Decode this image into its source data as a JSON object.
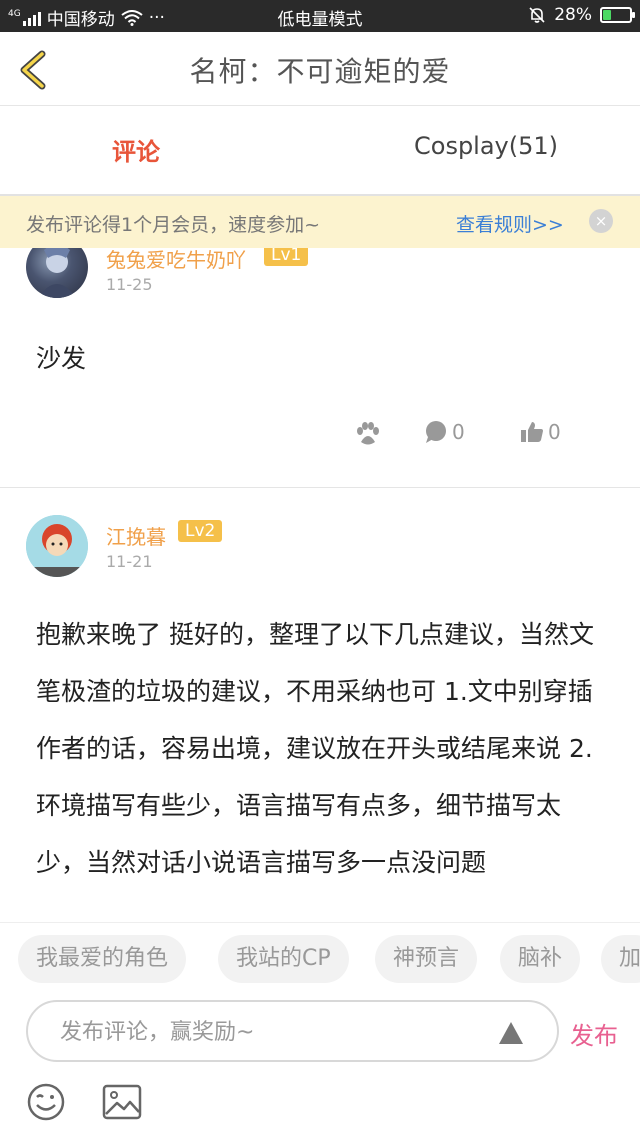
{
  "status_bar": {
    "signal_label": "4G",
    "carrier": "中国移动",
    "dots": "···",
    "mode": "低电量模式",
    "battery_percent": "28%",
    "battery_level": 0.28
  },
  "navbar": {
    "title": "名柯：不可逾矩的爱"
  },
  "tabs": [
    {
      "label": "评论",
      "active": true
    },
    {
      "label": "Cosplay(51)",
      "active": false
    }
  ],
  "banner": {
    "text": "发布评论得1个月会员，速度参加~",
    "link": "查看规则>>",
    "close": "×"
  },
  "comments": [
    {
      "username": "兔兔爱吃牛奶吖",
      "level": "Lv1",
      "date": "11-25",
      "text": "沙发",
      "paw_icon": "paw-icon",
      "reply_count": "0",
      "like_count": "0"
    },
    {
      "username": "江挽暮",
      "level": "Lv2",
      "date": "11-21",
      "text": "抱歉来晚了 挺好的，整理了以下几点建议，当然文笔极渣的垃圾的建议，不用采纳也可 1.文中别穿插作者的话，容易出境，建议放在开头或结尾来说 2.环境描写有些少，语言描写有点多，细节描写太少，当然对话小说语言描写多一点没问题"
    }
  ],
  "chips": [
    "我最爱的角色",
    "我站的CP",
    "神预言",
    "脑补",
    "加"
  ],
  "input": {
    "placeholder": "发布评论，赢奖励~",
    "send_label": "发布"
  },
  "colors": {
    "accent_red": "#e8553a",
    "username_orange": "#f0a04a",
    "level_badge": "#f5c04a",
    "banner_bg": "#fcf3cf",
    "link_blue": "#3b7fd6",
    "send_pink": "#e86090"
  }
}
